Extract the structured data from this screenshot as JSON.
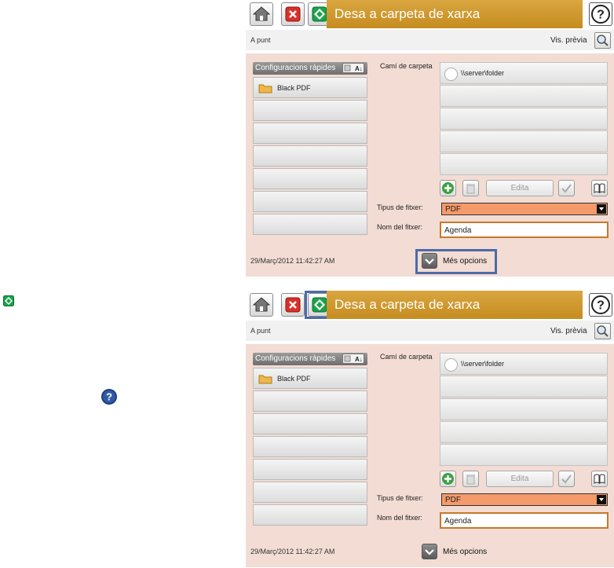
{
  "panels": [
    {
      "title": "Desa a carpeta de xarxa",
      "status": "A punt",
      "preview_label": "Vis. prèvia",
      "quick_sets": {
        "header": "Configuracions ràpides",
        "sort_icon": "A↓Z",
        "items": [
          "Black PDF",
          "",
          "",
          "",
          "",
          "",
          ""
        ]
      },
      "folder_path_label": "Camí de carpeta",
      "folders": [
        "\\\\server\\folder",
        "",
        "",
        "",
        ""
      ],
      "edit_label": "Edita",
      "file_type_label": "Tipus de fitxer:",
      "file_type_value": "PDF",
      "file_name_label": "Nom del fitxer:",
      "file_name_value": "Agenda",
      "datetime": "29/Març/2012 11:42:27 AM",
      "more_options": "Més opcions",
      "highlight": "more-options"
    },
    {
      "title": "Desa a carpeta de xarxa",
      "status": "A punt",
      "preview_label": "Vis. prèvia",
      "quick_sets": {
        "header": "Configuracions ràpides",
        "sort_icon": "A↓Z",
        "items": [
          "Black PDF",
          "",
          "",
          "",
          "",
          "",
          ""
        ]
      },
      "folder_path_label": "Camí de carpeta",
      "folders": [
        "\\\\server\\folder",
        "",
        "",
        "",
        ""
      ],
      "edit_label": "Edita",
      "file_type_label": "Tipus de fitxer:",
      "file_type_value": "PDF",
      "file_name_label": "Nom del fitxer:",
      "file_name_value": "Agenda",
      "datetime": "29/Març/2012 11:42:27 AM",
      "more_options": "Més opcions",
      "highlight": "start"
    }
  ],
  "side_icons": {
    "start": "start-icon",
    "help": "help-icon"
  },
  "colors": {
    "title_bar": "#c8901f",
    "main_area": "#f2dcd4",
    "highlight": "#4d6ba8",
    "file_type_select": "#f59a6a",
    "file_name_border": "#c8782a"
  }
}
